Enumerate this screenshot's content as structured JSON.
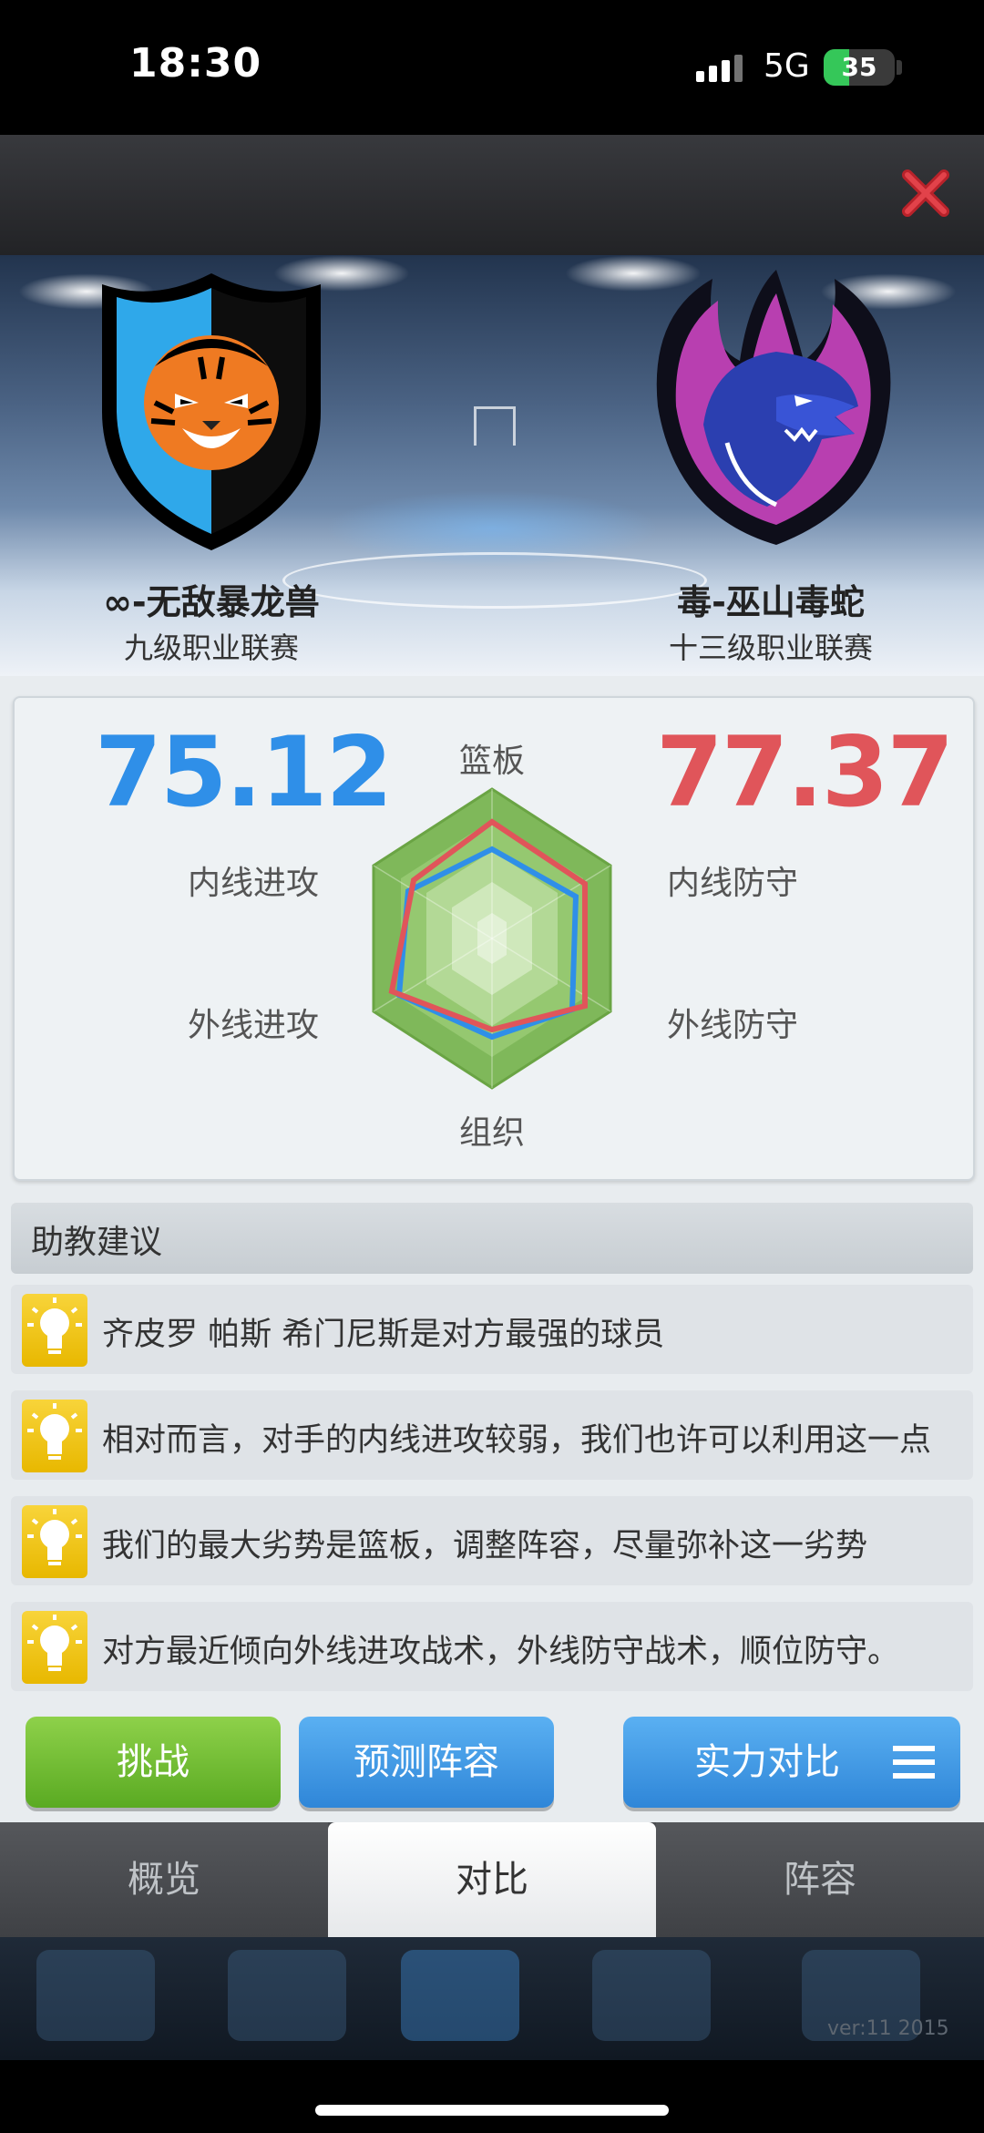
{
  "status_bar": {
    "time": "18:30",
    "network": "5G",
    "battery": "35"
  },
  "header": {
    "close_icon": "close-x-icon"
  },
  "teams": {
    "left": {
      "name": "∞-无敌暴龙兽",
      "league": "九级职业联赛",
      "logo": "tiger-shield-logo"
    },
    "right": {
      "name": "毒-巫山毒蛇",
      "league": "十三级职业联赛",
      "logo": "dragon-logo"
    }
  },
  "compare": {
    "left_score": "75.12",
    "right_score": "77.37",
    "axes": {
      "rebound": "篮板",
      "inside_attack": "内线进攻",
      "outside_attack": "外线进攻",
      "inside_defense": "内线防守",
      "outside_defense": "外线防守",
      "organize": "组织"
    },
    "colors": {
      "left": "#2f8fe8",
      "right": "#e0555a"
    }
  },
  "advice": {
    "title": "助教建议",
    "items": [
      "齐皮罗 帕斯 希门尼斯是对方最强的球员",
      "相对而言，对手的内线进攻较弱，我们也许可以利用这一点",
      "我们的最大劣势是篮板，调整阵容，尽量弥补这一劣势",
      "对方最近倾向外线进攻战术，外线防守战术，顺位防守。"
    ]
  },
  "actions": {
    "challenge": "挑战",
    "predict_lineup": "预测阵容",
    "strength_compare": "实力对比"
  },
  "tabs": {
    "overview": "概览",
    "compare": "对比",
    "lineup": "阵容"
  },
  "footer": {
    "version": "ver:11  2015"
  }
}
